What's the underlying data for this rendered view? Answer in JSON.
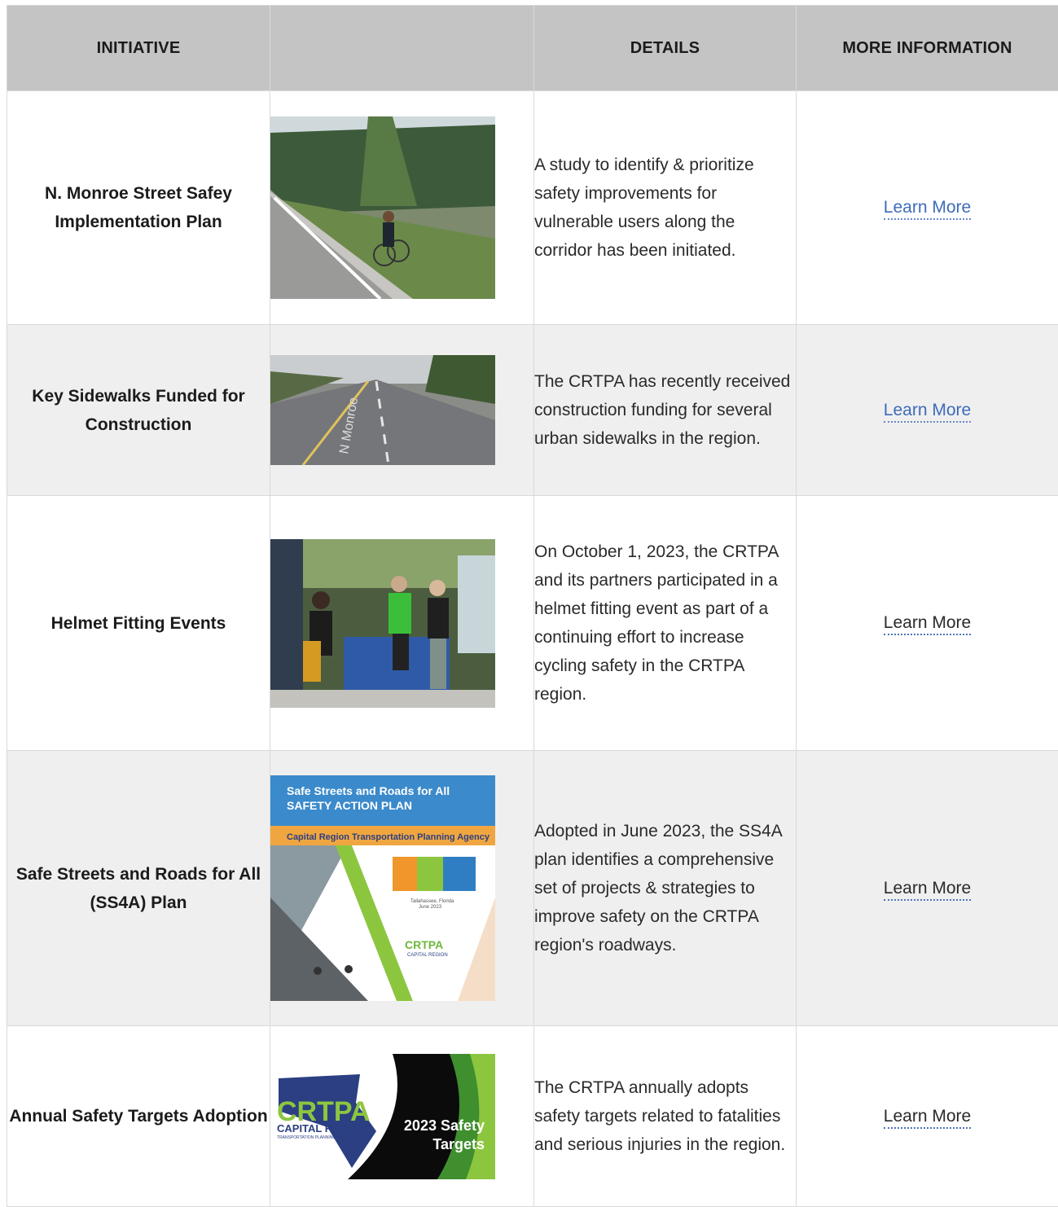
{
  "header": {
    "initiative": "INITIATIVE",
    "image": "",
    "details": "DETAILS",
    "more_info": "MORE INFORMATION"
  },
  "rows": [
    {
      "name": "N. Monroe Street Safey Implementation Plan",
      "details": "A study to identify & prioritize safety improvements for vulnerable users along the corridor has been initiated.",
      "link": "Learn More",
      "link_color": "#3e6bb9"
    },
    {
      "name": "Key Sidewalks Funded for Construction",
      "details": "The CRTPA has recently received construction funding for several urban sidewalks in the region.",
      "link": "Learn More",
      "link_color": "#3e6bb9",
      "image_text": "N Monroe"
    },
    {
      "name": "Helmet Fitting Events",
      "details": "On October 1, 2023, the CRTPA and its partners participated in a helmet fitting event as part of a continuing effort to increase cycling safety in the CRTPA region.",
      "link": "Learn More",
      "link_color": "#2a2a2a"
    },
    {
      "name": "Safe Streets and Roads for All (SS4A) Plan",
      "details": "Adopted in June 2023, the SS4A plan identifies a comprehensive set of projects & strategies to improve safety on the CRTPA region's roadways.",
      "link": "Learn More",
      "link_color": "#2a2a2a",
      "image_text": {
        "line1": "Safe Streets and Roads for All",
        "line2": "SAFETY ACTION PLAN",
        "agency": "Capital Region Transportation Planning Agency",
        "place": "Tallahassee, Florida",
        "date": "June 2023",
        "logo": "CRTPA",
        "logo_sub": "CAPITAL REGION"
      }
    },
    {
      "name": "Annual Safety Targets Adoption",
      "details": "The CRTPA annually adopts safety targets related to fatalities and serious injuries in the region.",
      "link": "Learn More",
      "link_color": "#2a2a2a",
      "image_text": {
        "logo": "CRTPA",
        "logo_sub": "CAPITAL REGION",
        "logo_tag": "TRANSPORTATION PLANNING AGENCY",
        "title1": "2023 Safety",
        "title2": "Targets"
      }
    }
  ]
}
